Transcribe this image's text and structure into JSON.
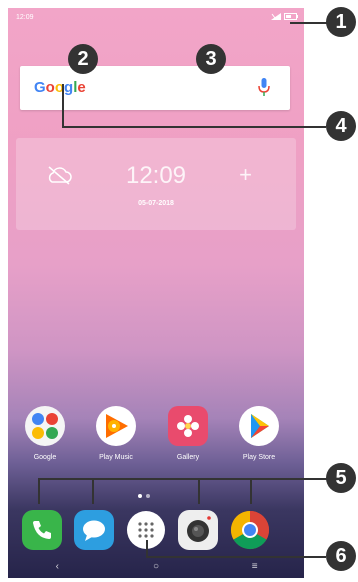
{
  "status_bar": {
    "time": "12:09"
  },
  "search_widget": {
    "logo": "Google"
  },
  "clock_widget": {
    "time": "12:09",
    "date": "05-07-2018",
    "plus": "+"
  },
  "apps": [
    {
      "label": "Google",
      "icon": "google-folder-icon"
    },
    {
      "label": "Play Music",
      "icon": "play-music-icon"
    },
    {
      "label": "Gallery",
      "icon": "gallery-icon"
    },
    {
      "label": "Play Store",
      "icon": "play-store-icon"
    }
  ],
  "dock": [
    {
      "icon": "phone-icon"
    },
    {
      "icon": "messages-icon"
    },
    {
      "icon": "app-drawer-icon"
    },
    {
      "icon": "camera-icon"
    },
    {
      "icon": "chrome-icon"
    }
  ],
  "nav_bar": {
    "back": "‹",
    "home": "○",
    "recents": "≡"
  },
  "callouts": [
    "1",
    "2",
    "3",
    "4",
    "5",
    "6"
  ],
  "colors": {
    "callout": "#333333",
    "phone": "#39b54a",
    "messages": "#2d9ee0",
    "chrome_red": "#db4437",
    "chrome_yellow": "#f4b400",
    "chrome_green": "#0f9d58",
    "chrome_blue": "#4285f4"
  }
}
